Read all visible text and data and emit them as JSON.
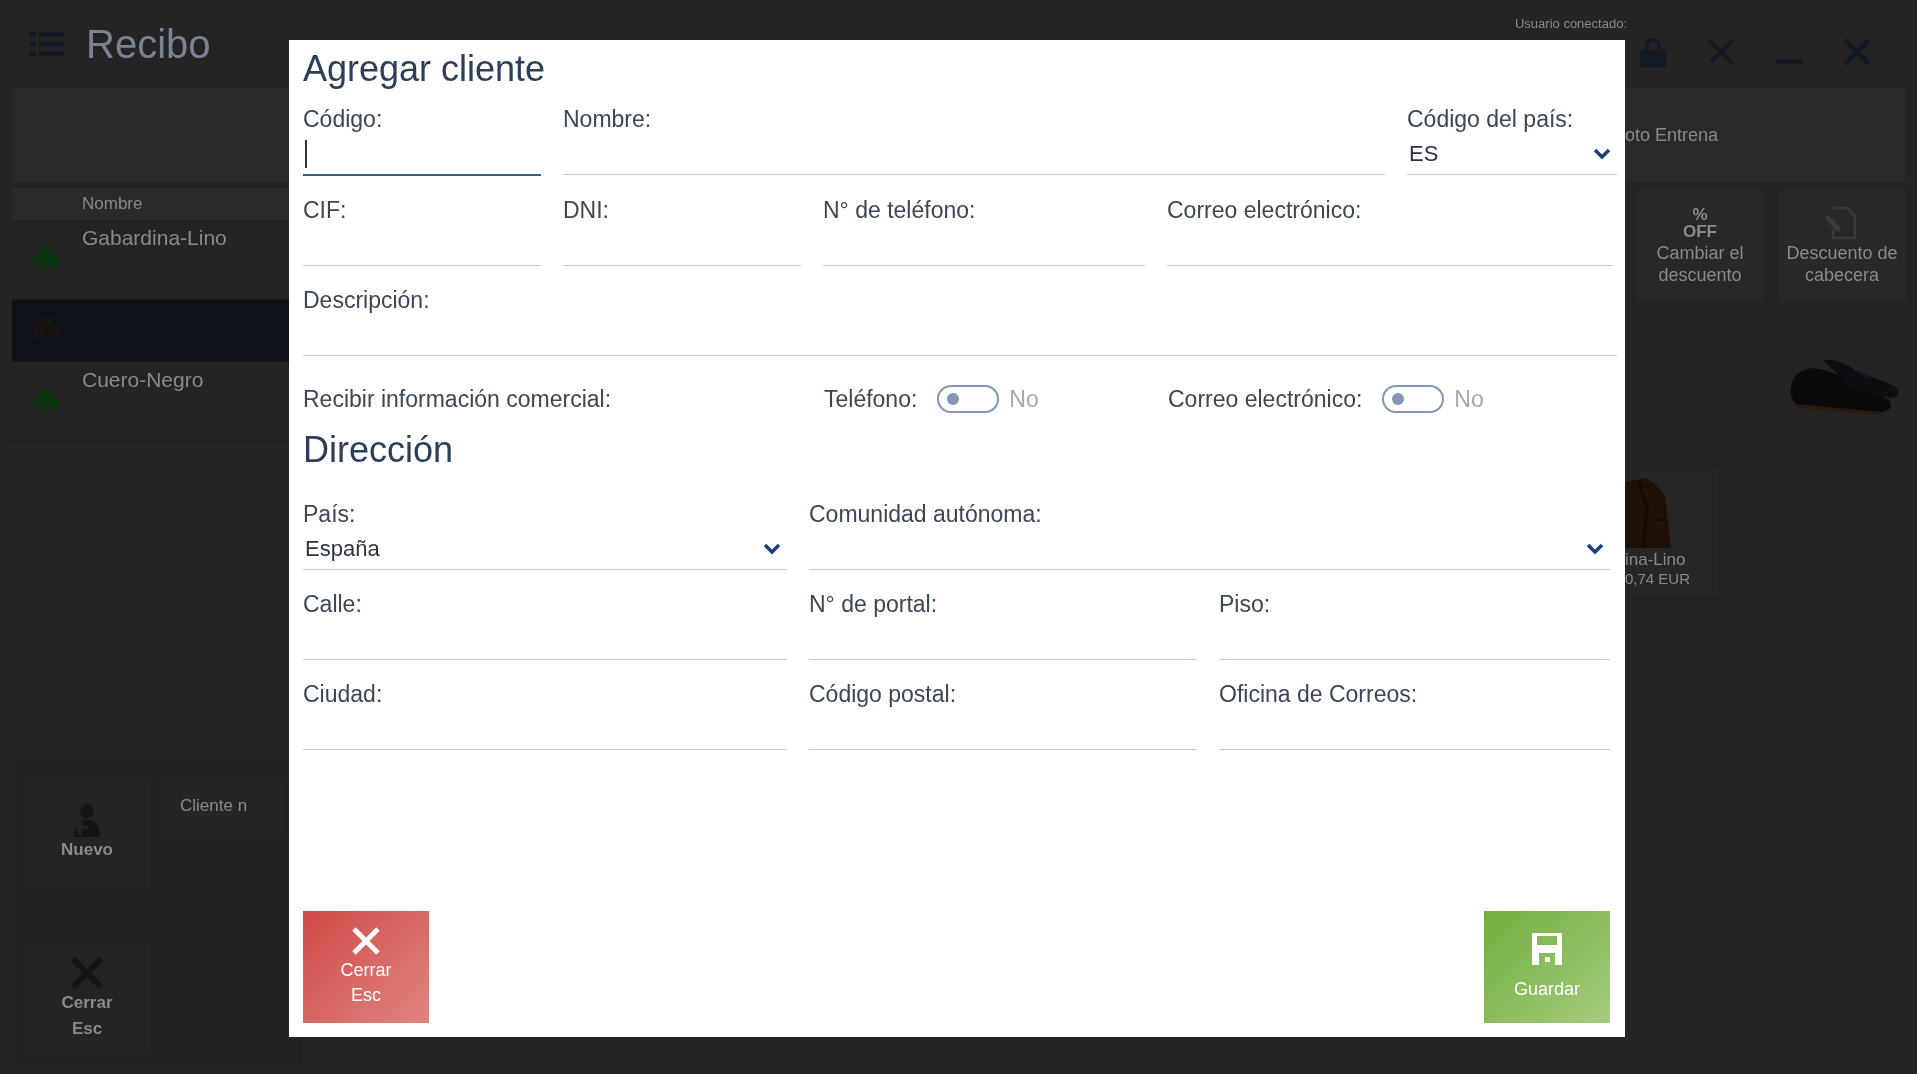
{
  "header": {
    "title": "Recibo",
    "user_label": "Usuario conectado:"
  },
  "search_band": {
    "text": "oto Entrena"
  },
  "item_list": {
    "column": "Nombre",
    "rows": [
      {
        "name": "Gabardina-Lino",
        "selected": false
      },
      {
        "selected": true
      },
      {
        "name": "Cuero-Negro",
        "selected": false
      }
    ]
  },
  "bottom_actions": [
    {
      "kind": "new",
      "label": "Nuevo"
    },
    {
      "kind": "close",
      "label": "Cerrar",
      "hint": "Esc"
    }
  ],
  "customer_hint": "Cliente n",
  "tiles": [
    {
      "kind": "percent",
      "icon_lines": [
        "%",
        "OFF"
      ],
      "label": "Cambiar el descuento"
    },
    {
      "kind": "document",
      "label": "Descuento de cabecera"
    }
  ],
  "product": {
    "name": "ina-Lino",
    "price": "0,74 EUR"
  },
  "dialog": {
    "title": "Agregar cliente",
    "rows": [
      [
        {
          "label": "Código:",
          "kind": "text",
          "focused": true
        },
        {
          "label": "Nombre:",
          "kind": "text",
          "focused": false
        },
        {
          "label": "Código del país:",
          "kind": "select",
          "value": "ES",
          "focused": false
        }
      ],
      [
        {
          "label": "CIF:",
          "kind": "text",
          "focused": false
        },
        {
          "label": "DNI:",
          "kind": "text",
          "focused": false
        },
        {
          "label": "N° de teléfono:",
          "kind": "text",
          "focused": false
        },
        {
          "label": "Correo electrónico:",
          "kind": "text",
          "focused": false
        }
      ],
      [
        {
          "label": "Descripción:",
          "kind": "text",
          "focused": false
        }
      ]
    ],
    "commercial": {
      "label": "Recibir información comercial:",
      "channels": [
        {
          "label": "Teléfono:",
          "on": false,
          "state": "No"
        },
        {
          "label": "Correo electrónico:",
          "on": false,
          "state": "No"
        }
      ]
    },
    "address_title": "Dirección",
    "address_rows": [
      [
        {
          "label": "País:",
          "kind": "select",
          "value": "España",
          "focused": false
        },
        {
          "label": "Comunidad autónoma:",
          "kind": "select",
          "focused": false
        }
      ],
      [
        {
          "label": "Calle:",
          "kind": "text",
          "focused": false
        },
        {
          "label": "N° de portal:",
          "kind": "text",
          "focused": false
        },
        {
          "label": "Piso:",
          "kind": "text",
          "focused": false
        }
      ],
      [
        {
          "label": "Ciudad:",
          "kind": "text",
          "focused": false
        },
        {
          "label": "Código postal:",
          "kind": "text",
          "focused": false
        },
        {
          "label": "Oficina de Correos:",
          "kind": "text",
          "focused": false
        }
      ]
    ],
    "buttons": [
      {
        "kind": "close",
        "label": "Cerrar",
        "hint": "Esc"
      },
      {
        "kind": "save",
        "label": "Guardar"
      }
    ]
  }
}
